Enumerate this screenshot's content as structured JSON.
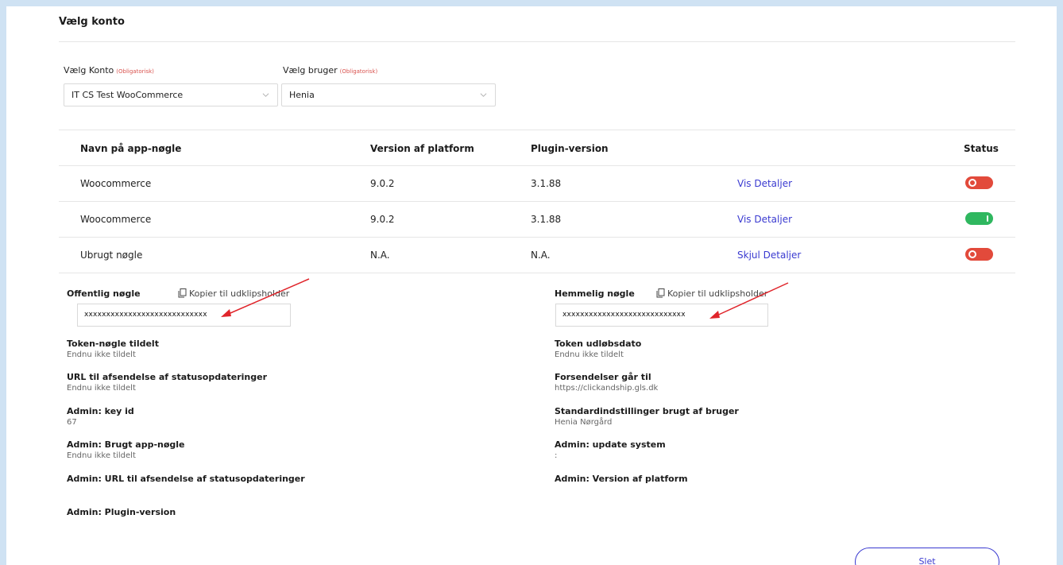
{
  "section": {
    "title": "Vælg konto"
  },
  "account": {
    "label": "Vælg Konto",
    "required": "(Obligatorisk)",
    "value": "IT CS Test WooCommerce"
  },
  "user": {
    "label": "Vælg bruger",
    "required": "(Obligatorisk)",
    "value": "Henia"
  },
  "table": {
    "headers": {
      "name": "Navn på app-nøgle",
      "platform": "Version af platform",
      "plugin": "Plugin-version",
      "status": "Status"
    },
    "rows": [
      {
        "name": "Woocommerce",
        "platform": "9.0.2",
        "plugin": "3.1.88",
        "link": "Vis Detaljer",
        "status": "off"
      },
      {
        "name": "Woocommerce",
        "platform": "9.0.2",
        "plugin": "3.1.88",
        "link": "Vis Detaljer",
        "status": "on"
      },
      {
        "name": "Ubrugt nøgle",
        "platform": "N.A.",
        "plugin": "N.A.",
        "link": "Skjul Detaljer",
        "status": "off"
      }
    ]
  },
  "details": {
    "public_key": {
      "label": "Offentlig nøgle",
      "copy": "Kopier til udklipsholder",
      "value": "xxxxxxxxxxxxxxxxxxxxxxxxxxxx"
    },
    "secret_key": {
      "label": "Hemmelig nøgle",
      "copy": "Kopier til udklipsholder",
      "value": "xxxxxxxxxxxxxxxxxxxxxxxxxxxx"
    },
    "left": [
      {
        "label": "Token-nøgle tildelt",
        "value": "Endnu ikke tildelt"
      },
      {
        "label": "URL til afsendelse af statusopdateringer",
        "value": "Endnu ikke tildelt"
      },
      {
        "label": "Admin: key id",
        "value": "67"
      },
      {
        "label": "Admin: Brugt app-nøgle",
        "value": "Endnu ikke tildelt"
      },
      {
        "label": "Admin: URL til afsendelse af statusopdateringer",
        "value": ""
      },
      {
        "label": "Admin: Plugin-version",
        "value": ""
      }
    ],
    "right": [
      {
        "label": "Token udløbsdato",
        "value": "Endnu ikke tildelt"
      },
      {
        "label": "Forsendelser går til",
        "value": "https://clickandship.gls.dk"
      },
      {
        "label": "Standardindstillinger brugt af bruger",
        "value": "Henia Nørgård"
      },
      {
        "label": "Admin: update system",
        "value": ":"
      },
      {
        "label": "Admin: Version af platform",
        "value": ""
      }
    ]
  },
  "actions": {
    "delete_label": "Slet"
  },
  "colors": {
    "accent": "#3a3ad0",
    "status_off": "#e24a3b",
    "status_on": "#2fb75f",
    "annotation_arrow": "#e0242a"
  }
}
